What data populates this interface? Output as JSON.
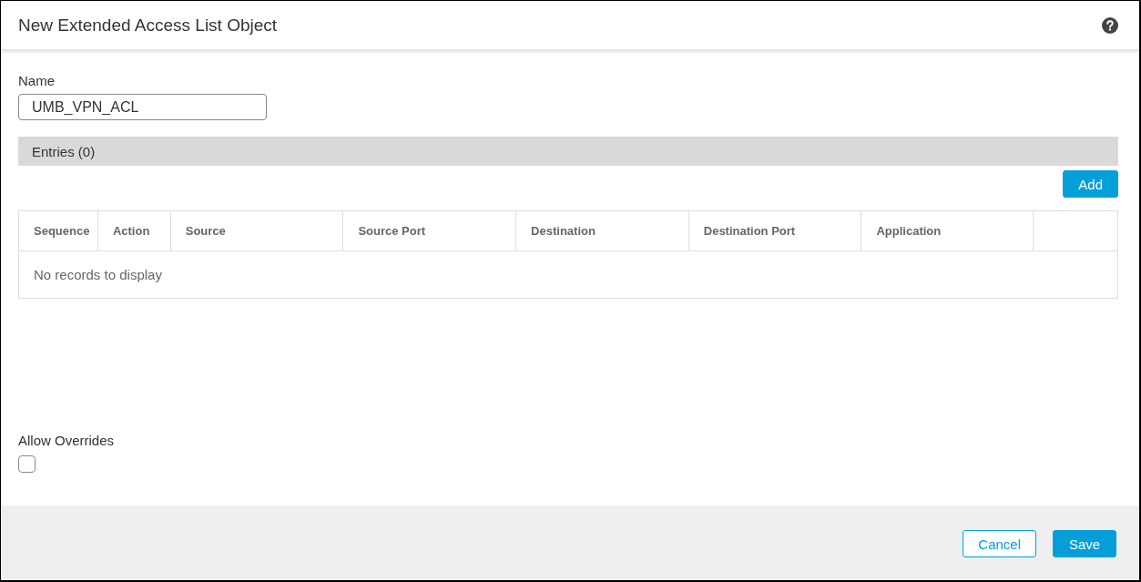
{
  "dialog": {
    "title": "New Extended Access List Object"
  },
  "name_field": {
    "label": "Name",
    "value": "UMB_VPN_ACL"
  },
  "entries": {
    "title": "Entries (0)",
    "add_button": "Add",
    "columns": [
      "Sequence",
      "Action",
      "Source",
      "Source Port",
      "Destination",
      "Destination Port",
      "Application",
      ""
    ],
    "empty_message": "No records to display"
  },
  "allow_overrides": {
    "label": "Allow Overrides",
    "checked": false
  },
  "footer_buttons": [
    {
      "label": "Cancel",
      "kind": "secondary"
    },
    {
      "label": "Save",
      "kind": "primary"
    }
  ]
}
